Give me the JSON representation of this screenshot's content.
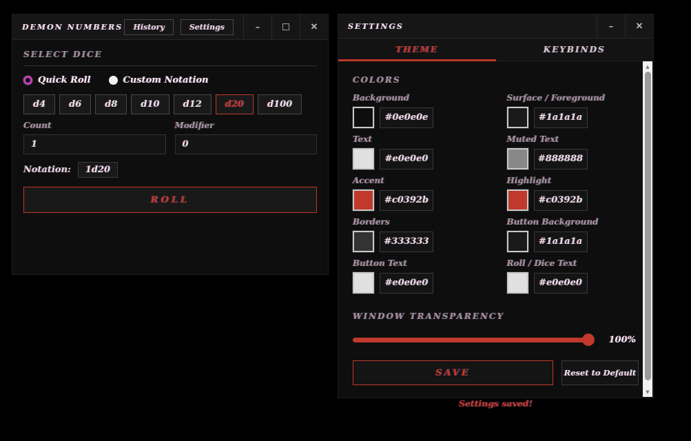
{
  "theme": {
    "page_background": "#000000",
    "window_background": "#0e0e0e",
    "surface": "#1a1a1a",
    "text": "#e0e0e0",
    "muted": "#888888",
    "accent": "#c0392b",
    "border": "#333333",
    "quick_roll_radio_accent": "#c63fc0"
  },
  "dice_window": {
    "title": "DEMON NUMBERS",
    "toolbar": {
      "history": "History",
      "settings": "Settings"
    },
    "controls": {
      "minimize": "–",
      "close": "✕"
    },
    "select_dice": {
      "heading": "SELECT DICE",
      "modes": [
        {
          "label": "Quick Roll",
          "selected": true
        },
        {
          "label": "Custom Notation",
          "selected": false
        }
      ],
      "dice": [
        {
          "label": "d4",
          "active": false
        },
        {
          "label": "d6",
          "active": false
        },
        {
          "label": "d8",
          "active": false
        },
        {
          "label": "d10",
          "active": false
        },
        {
          "label": "d12",
          "active": false
        },
        {
          "label": "d20",
          "active": true
        },
        {
          "label": "d100",
          "active": false
        }
      ]
    },
    "count": {
      "label": "Count",
      "value": "1"
    },
    "modifier": {
      "label": "Modifier",
      "value": "0"
    },
    "notation": {
      "label": "Notation:",
      "value": "1d20"
    },
    "roll_label": "ROLL"
  },
  "settings_window": {
    "title": "SETTINGS",
    "controls": {
      "minimize": "–",
      "close": "✕"
    },
    "tabs": [
      {
        "label": "THEME",
        "active": true
      },
      {
        "label": "KEYBINDS",
        "active": false
      }
    ],
    "colors_section": {
      "heading": "COLORS",
      "fields": [
        {
          "label": "Background",
          "value": "#0e0e0e"
        },
        {
          "label": "Surface / Foreground",
          "value": "#1a1a1a"
        },
        {
          "label": "Text",
          "value": "#e0e0e0"
        },
        {
          "label": "Muted Text",
          "value": "#888888"
        },
        {
          "label": "Accent",
          "value": "#c0392b"
        },
        {
          "label": "Highlight",
          "value": "#c0392b"
        },
        {
          "label": "Borders",
          "value": "#333333"
        },
        {
          "label": "Button Background",
          "value": "#1a1a1a"
        },
        {
          "label": "Button Text",
          "value": "#e0e0e0"
        },
        {
          "label": "Roll / Dice Text",
          "value": "#e0e0e0"
        }
      ]
    },
    "transparency": {
      "heading": "WINDOW TRANSPARENCY",
      "percent": 100,
      "value_label": "100%"
    },
    "save_label": "SAVE",
    "reset_label": "Reset to Default",
    "status_message": "Settings saved!"
  },
  "scrollbar": {
    "up_icon": "▲",
    "down_icon": "▼"
  }
}
